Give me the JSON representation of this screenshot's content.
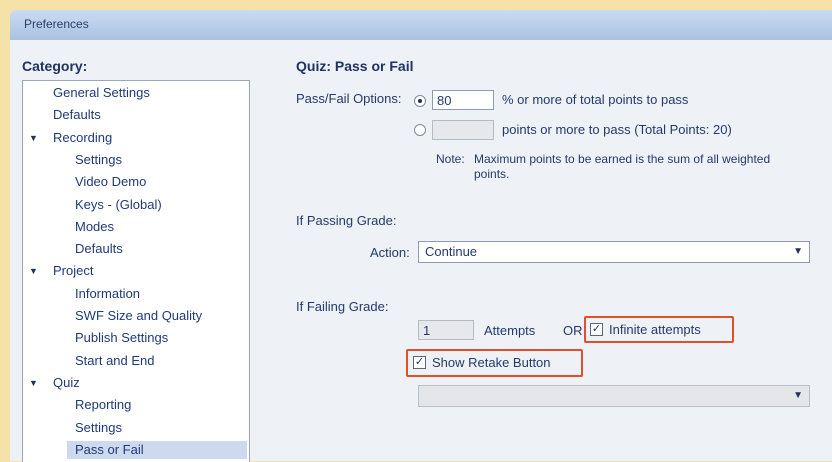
{
  "window": {
    "title": "Preferences"
  },
  "category": {
    "label": "Category:",
    "items": [
      {
        "label": "General Settings",
        "indent": 1
      },
      {
        "label": "Defaults",
        "indent": 1
      },
      {
        "label": "Recording",
        "indent": 1,
        "expanded": true
      },
      {
        "label": "Settings",
        "indent": 2
      },
      {
        "label": "Video Demo",
        "indent": 2
      },
      {
        "label": "Keys - (Global)",
        "indent": 2
      },
      {
        "label": "Modes",
        "indent": 2
      },
      {
        "label": "Defaults",
        "indent": 2
      },
      {
        "label": "Project",
        "indent": 1,
        "expanded": true
      },
      {
        "label": "Information",
        "indent": 2
      },
      {
        "label": "SWF Size and Quality",
        "indent": 2
      },
      {
        "label": "Publish Settings",
        "indent": 2
      },
      {
        "label": "Start and End",
        "indent": 2
      },
      {
        "label": "Quiz",
        "indent": 1,
        "expanded": true
      },
      {
        "label": "Reporting",
        "indent": 2
      },
      {
        "label": "Settings",
        "indent": 2
      },
      {
        "label": "Pass or Fail",
        "indent": 2,
        "selected": true
      }
    ]
  },
  "panel": {
    "title": "Quiz: Pass or Fail",
    "pass_fail_label": "Pass/Fail Options:",
    "percent_value": "80",
    "percent_text": "% or more of total points to pass",
    "points_text": "points or more to pass (Total Points: 20)",
    "note_label": "Note:",
    "note_text": "Maximum points to be earned is the sum of all weighted points.",
    "passing_label": "If Passing Grade:",
    "action_label": "Action:",
    "action_value": "Continue",
    "failing_label": "If Failing Grade:",
    "attempts_value": "1",
    "attempts_label": "Attempts",
    "or_label": "OR",
    "infinite_label": "Infinite attempts",
    "retake_label": "Show Retake Button",
    "checkmark": "✓",
    "dropdown_arrow": "▼"
  },
  "colors": {
    "highlight": "#e0502a",
    "selection": "#cdd9ee"
  }
}
